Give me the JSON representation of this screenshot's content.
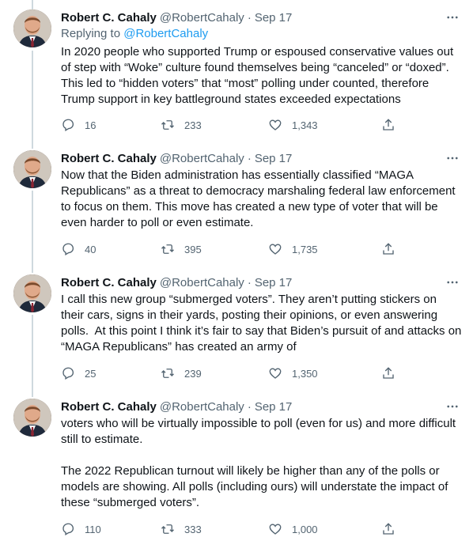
{
  "author": {
    "name": "Robert C. Cahaly",
    "handle": "@RobertCahaly",
    "separator": "·"
  },
  "tweets": [
    {
      "date": "Sep 17",
      "replying_prefix": "Replying to",
      "replying_handle": "@RobertCahaly",
      "text": "In 2020 people who supported Trump or espoused conservative values out of step with “Woke” culture found themselves being “canceled” or “doxed”. This led to “hidden voters” that “most” polling under counted, therefore Trump support in key battleground states exceeded expectations",
      "replies": "16",
      "retweets": "233",
      "likes": "1,343"
    },
    {
      "date": "Sep 17",
      "text": "Now that the Biden administration has essentially classified “MAGA Republicans” as a threat to democracy marshaling federal law enforcement to focus on them. This move has created a new type of voter that will be even harder to poll or even estimate.",
      "replies": "40",
      "retweets": "395",
      "likes": "1,735"
    },
    {
      "date": "Sep 17",
      "text": "I call this new group “submerged voters”. They aren’t putting stickers on their cars, signs in their yards, posting their opinions, or even answering polls.  At this point I think it’s fair to say that Biden’s pursuit of and attacks on “MAGA Republicans” has created an army of",
      "replies": "25",
      "retweets": "239",
      "likes": "1,350"
    },
    {
      "date": "Sep 17",
      "text": "voters who will be virtually impossible to poll (even for us) and more difficult still to estimate.\n\nThe 2022 Republican turnout will likely be higher than any of the polls or models are showing. All polls (including ours) will understate the impact of these “submerged voters”.",
      "replies": "110",
      "retweets": "333",
      "likes": "1,000"
    }
  ],
  "icons": {
    "reply": "reply-icon",
    "retweet": "retweet-icon",
    "like": "heart-icon",
    "share": "share-icon",
    "more": "more-icon"
  },
  "colors": {
    "text": "#0f1419",
    "secondary": "#536471",
    "link": "#1d9bf0",
    "thread_line": "#cfd9de"
  }
}
